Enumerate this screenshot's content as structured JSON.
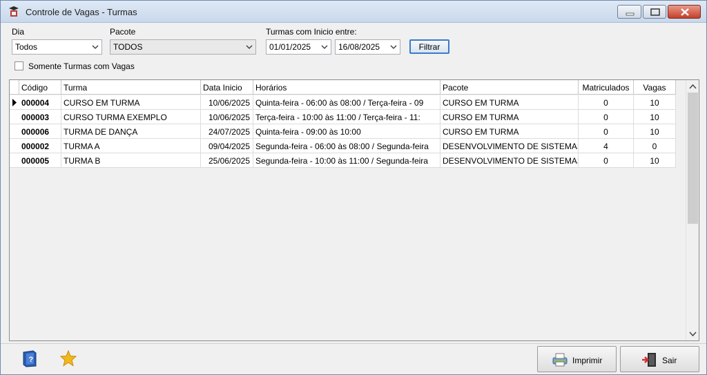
{
  "window": {
    "title": "Controle de Vagas - Turmas"
  },
  "filters": {
    "dia": {
      "label": "Dia",
      "value": "Todos"
    },
    "pacote": {
      "label": "Pacote",
      "value": "TODOS"
    },
    "periodo": {
      "label": "Turmas com Inicio entre:",
      "start": "01/01/2025",
      "end": "16/08/2025"
    },
    "filter_button": "Filtrar",
    "only_vacancies": {
      "label": "Somente Turmas com Vagas",
      "checked": false
    }
  },
  "grid": {
    "columns": [
      "Código",
      "Turma",
      "Data Inicio",
      "Horários",
      "Pacote",
      "Matriculados",
      "Vagas"
    ],
    "rows": [
      {
        "codigo": "000004",
        "turma": "CURSO EM TURMA",
        "data": "10/06/2025",
        "horarios": "Quinta-feira - 06:00 às 08:00 / Terça-feira - 09",
        "pacote": "CURSO EM TURMA",
        "matriculados": "0",
        "vagas": "10"
      },
      {
        "codigo": "000003",
        "turma": "CURSO TURMA EXEMPLO",
        "data": "10/06/2025",
        "horarios": "Terça-feira - 10:00 às 11:00 / Terça-feira - 11:",
        "pacote": "CURSO EM TURMA",
        "matriculados": "0",
        "vagas": "10"
      },
      {
        "codigo": "000006",
        "turma": "TURMA DE DANÇA",
        "data": "24/07/2025",
        "horarios": "Quinta-feira - 09:00 às 10:00",
        "pacote": "CURSO EM TURMA",
        "matriculados": "0",
        "vagas": "10"
      },
      {
        "codigo": "000002",
        "turma": "TURMA A",
        "data": "09/04/2025",
        "horarios": "Segunda-feira - 06:00 às 08:00 / Segunda-feira",
        "pacote": "DESENVOLVIMENTO DE SISTEMAS",
        "matriculados": "4",
        "vagas": "0"
      },
      {
        "codigo": "000005",
        "turma": "TURMA B",
        "data": "25/06/2025",
        "horarios": "Segunda-feira - 10:00 às 11:00 / Segunda-feira",
        "pacote": "DESENVOLVIMENTO DE SISTEMAS",
        "matriculados": "0",
        "vagas": "10"
      }
    ]
  },
  "bottom": {
    "print_button": "Imprimir",
    "exit_button": "Sair"
  }
}
